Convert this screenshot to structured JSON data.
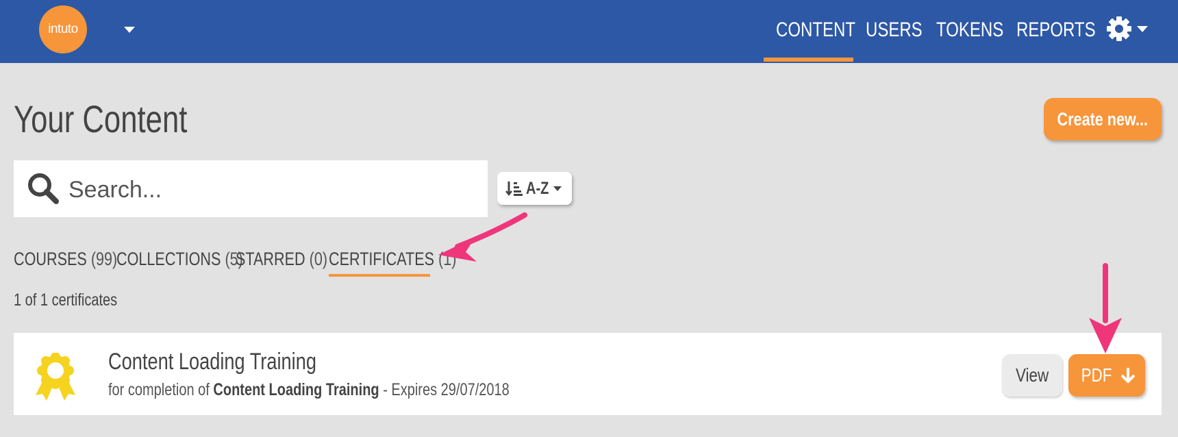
{
  "app": {
    "logo_text": "intuto"
  },
  "nav": {
    "items": [
      {
        "label": "CONTENT",
        "active": true
      },
      {
        "label": "USERS"
      },
      {
        "label": "TOKENS"
      },
      {
        "label": "REPORTS"
      }
    ],
    "settings_icon": "gear-icon"
  },
  "page": {
    "title": "Your Content",
    "create_label": "Create new..."
  },
  "search": {
    "placeholder": "Search...",
    "value": ""
  },
  "sort": {
    "label": "A-Z",
    "icon": "sort-alpha-icon"
  },
  "tabs": [
    {
      "label": "COURSES",
      "count": "(99)"
    },
    {
      "label": "COLLECTIONS",
      "count": "(5)"
    },
    {
      "label": "STARRED",
      "count": "(0)"
    },
    {
      "label": "CERTIFICATES",
      "count": "(1)",
      "active": true
    }
  ],
  "results": {
    "summary": "1 of 1 certificates"
  },
  "certificates": [
    {
      "title": "Content Loading Training",
      "prefix": "for completion of",
      "course": "Content Loading Training",
      "expires": "- Expires 29/07/2018",
      "view_label": "View",
      "pdf_label": "PDF",
      "icon": "certificate-ribbon-icon"
    }
  ],
  "colors": {
    "header": "#2d58a6",
    "accent": "#f7953a",
    "background": "#e2e2e2",
    "annotation": "#f0367a"
  }
}
